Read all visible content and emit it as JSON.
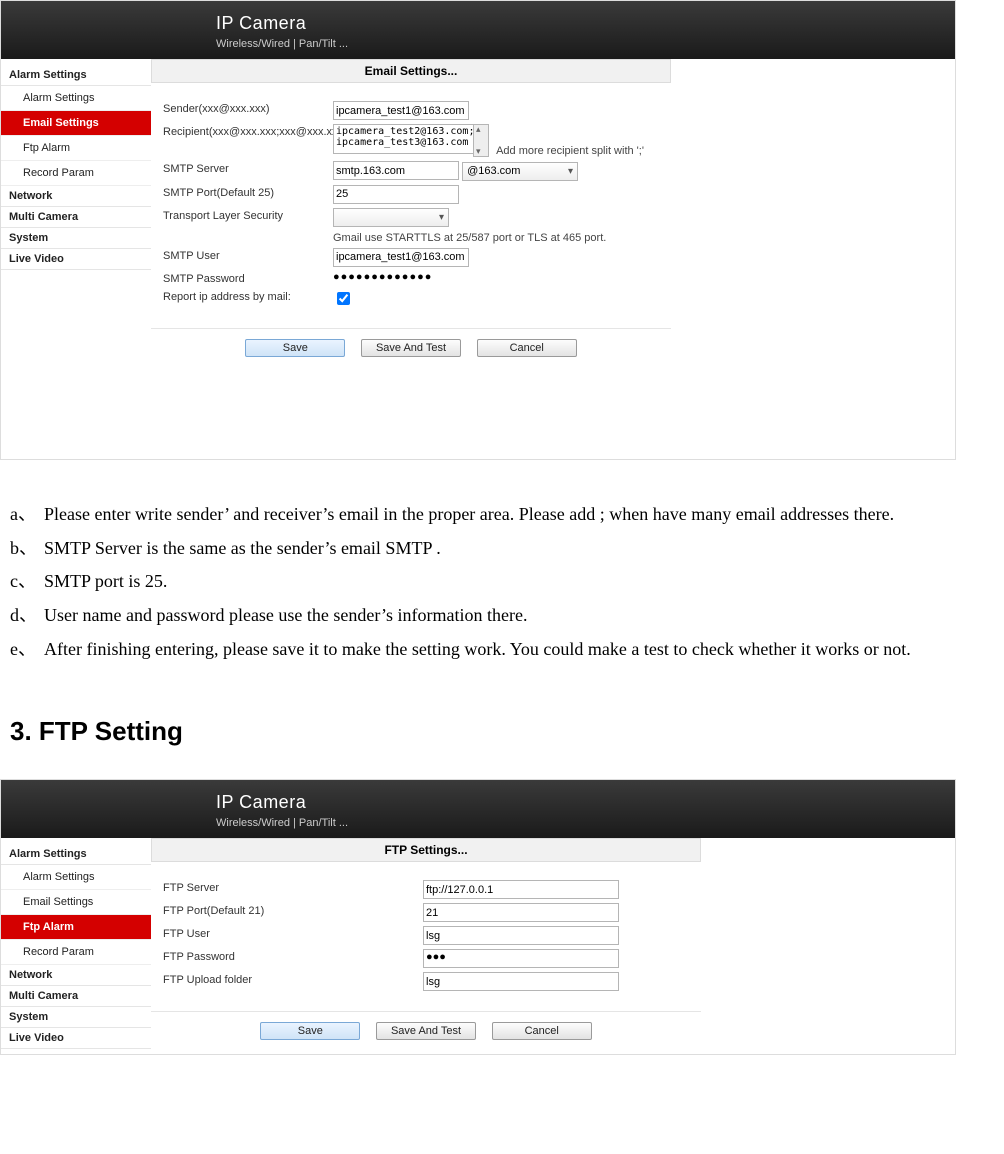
{
  "brand": {
    "title": "IP Camera",
    "sub": "Wireless/Wired  |  Pan/Tilt  ..."
  },
  "sidebar_email": {
    "group": "Alarm Settings",
    "items": [
      "Alarm Settings",
      "Email Settings",
      "Ftp Alarm",
      "Record Param"
    ],
    "active": "Email Settings",
    "others": [
      "Network",
      "Multi Camera",
      "System",
      "Live Video"
    ]
  },
  "sidebar_ftp": {
    "group": "Alarm Settings",
    "items": [
      "Alarm Settings",
      "Email Settings",
      "Ftp Alarm",
      "Record Param"
    ],
    "active": "Ftp Alarm",
    "others": [
      "Network",
      "Multi Camera",
      "System",
      "Live Video"
    ]
  },
  "email": {
    "panel_title": "Email Settings...",
    "sender_label": "Sender(xxx@xxx.xxx)",
    "sender_value": "ipcamera_test1@163.com",
    "recipient_label": "Recipient(xxx@xxx.xxx;xxx@xxx.xxx...)",
    "recipient_value": "ipcamera_test2@163.com;\nipcamera_test3@163.com",
    "recipient_hint": "Add more recipient split with ';'",
    "smtp_server_label": "SMTP Server",
    "smtp_server_value": "smtp.163.com",
    "smtp_server_select": "@163.com",
    "smtp_port_label": "SMTP Port(Default 25)",
    "smtp_port_value": "25",
    "tls_label": "Transport Layer Security",
    "tls_hint": "Gmail use STARTTLS at 25/587 port or TLS at 465 port.",
    "smtp_user_label": "SMTP User",
    "smtp_user_value": "ipcamera_test1@163.com",
    "smtp_pwd_label": "SMTP Password",
    "smtp_pwd_value": "●●●●●●●●●●●●●",
    "report_label": "Report ip address by mail:",
    "btn_save": "Save",
    "btn_test": "Save And Test",
    "btn_cancel": "Cancel"
  },
  "ftp": {
    "panel_title": "FTP Settings...",
    "server_label": "FTP Server",
    "server_value": "ftp://127.0.0.1",
    "port_label": "FTP Port(Default 21)",
    "port_value": "21",
    "user_label": "FTP User",
    "user_value": "lsg",
    "pwd_label": "FTP Password",
    "pwd_value": "●●●",
    "folder_label": "FTP Upload folder",
    "folder_value": "lsg",
    "btn_save": "Save",
    "btn_test": "Save And Test",
    "btn_cancel": "Cancel"
  },
  "doc": {
    "a": "Please enter write sender’ and receiver’s email in the proper area. Please add ; when have many email addresses there.",
    "b": " SMTP Server is the same as the sender’s email SMTP .",
    "c": "SMTP port is 25.",
    "d": "User name and password please use the sender’s information there.",
    "e": "After finishing entering, please save it to make the setting work. You could make a test to check whether it works or not.",
    "heading": "3. FTP Setting",
    "mk_a": "a、",
    "mk_b": "b、",
    "mk_c": "c、",
    "mk_d": "d、",
    "mk_e": "e、"
  }
}
